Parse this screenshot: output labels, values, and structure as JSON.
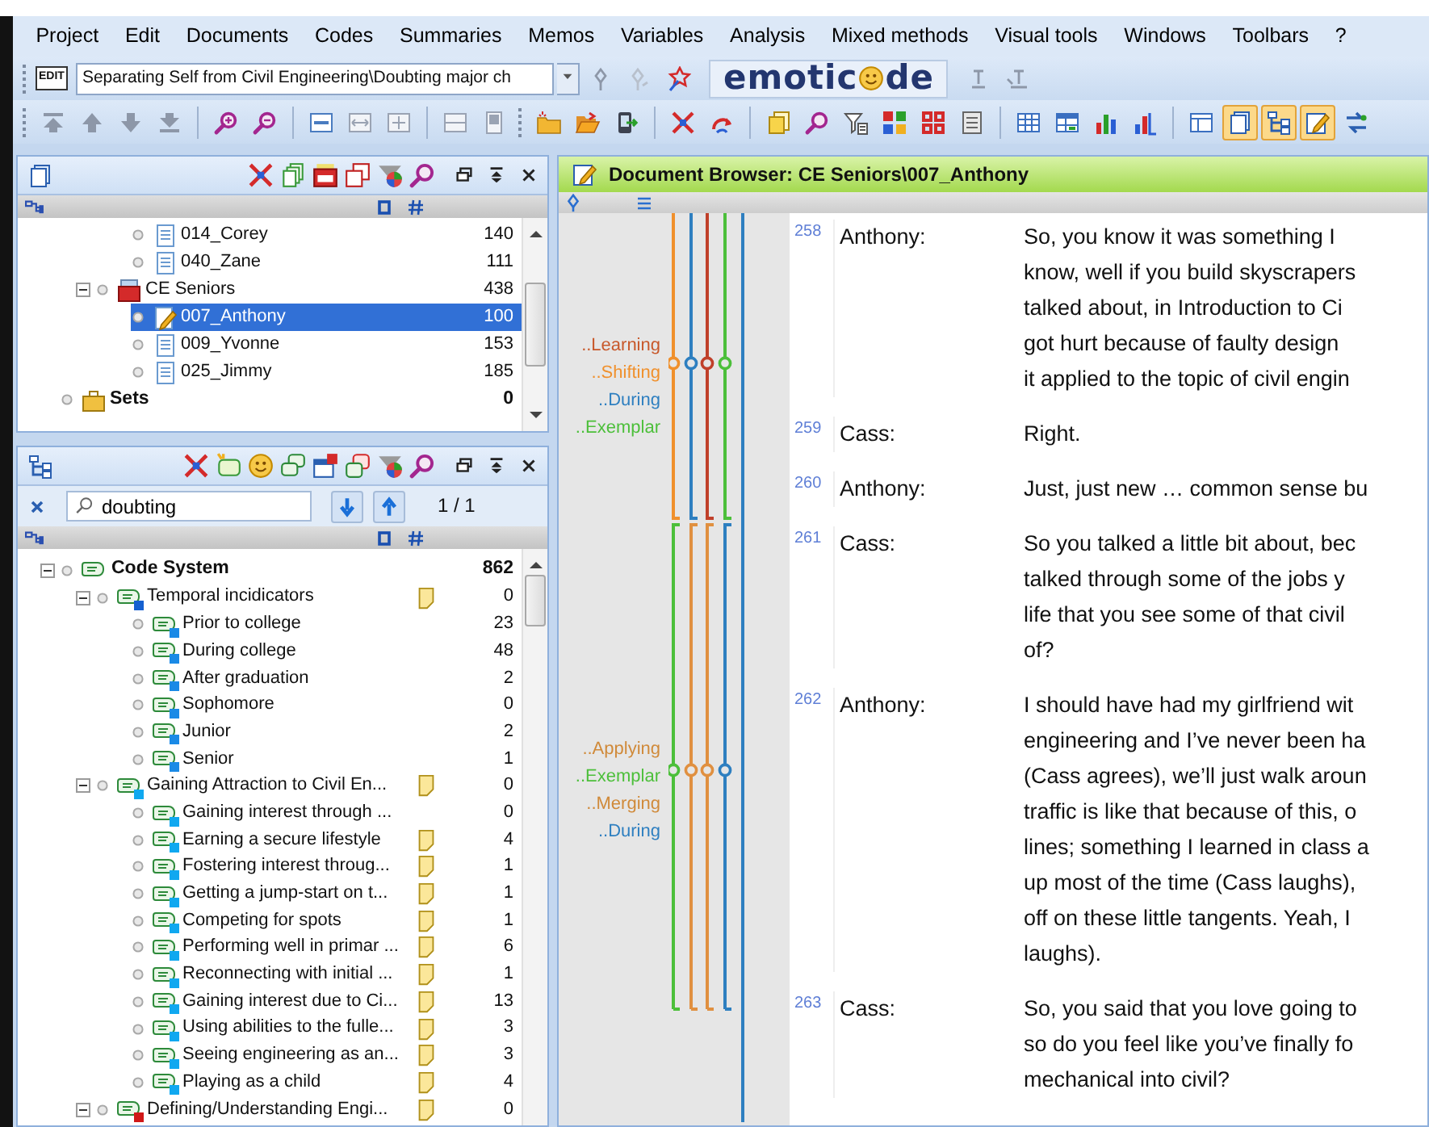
{
  "menu": [
    "Project",
    "Edit",
    "Documents",
    "Codes",
    "Summaries",
    "Memos",
    "Variables",
    "Analysis",
    "Mixed methods",
    "Visual tools",
    "Windows",
    "Toolbars",
    "?"
  ],
  "toolbar": {
    "edit_badge": "EDIT",
    "document_selector": {
      "value": "Separating Self from Civil Engineering\\Doubting major ch"
    },
    "logo": {
      "before": "emotic",
      "after": "de"
    },
    "window_toggles": [
      {
        "on": false
      },
      {
        "on": true
      },
      {
        "on": true
      },
      {
        "on": true
      }
    ]
  },
  "document_pane": {
    "items": [
      {
        "children": [
          {
            "children": [
              {
                "label": "014_Corey",
                "count": "140",
                "kind": "document",
                "selected": false
              },
              {
                "label": "040_Zane",
                "count": "111",
                "kind": "document",
                "selected": false
              }
            ]
          },
          {
            "label": "CE Seniors",
            "count": "438",
            "kind": "group",
            "expanded": true,
            "selected": false,
            "children": [
              {
                "label": "007_Anthony",
                "count": "100",
                "kind": "open-document",
                "selected": true
              },
              {
                "label": "009_Yvonne",
                "count": "153",
                "kind": "document",
                "selected": false
              },
              {
                "label": "025_Jimmy",
                "count": "185",
                "kind": "document",
                "selected": false
              }
            ]
          }
        ]
      },
      {
        "label": "Sets",
        "count": "0",
        "kind": "sets",
        "selected": false
      }
    ]
  },
  "code_pane": {
    "search": {
      "value": "doubting",
      "match_count": "1 / 1"
    },
    "items": [
      {
        "label": "Code System",
        "count": "862",
        "kind": "root",
        "expanded": true,
        "children": [
          {
            "label": "Temporal incidicators",
            "count": "0",
            "kind": "code",
            "memo": true,
            "color": "#1560d0",
            "expanded": true,
            "children": [
              {
                "label": "Prior to college",
                "count": "23",
                "kind": "code",
                "memo": false,
                "color": "#1a8ae6"
              },
              {
                "label": "During college",
                "count": "48",
                "kind": "code",
                "memo": false,
                "color": "#1a8ae6"
              },
              {
                "label": "After graduation",
                "count": "2",
                "kind": "code",
                "memo": false,
                "color": "#1a8ae6"
              },
              {
                "label": "Sophomore",
                "count": "0",
                "kind": "code",
                "memo": false,
                "color": "#1a8ae6"
              },
              {
                "label": "Junior",
                "count": "2",
                "kind": "code",
                "memo": false,
                "color": "#1a8ae6"
              },
              {
                "label": "Senior",
                "count": "1",
                "kind": "code",
                "memo": false,
                "color": "#1a8ae6"
              }
            ]
          },
          {
            "label": "Gaining Attraction to Civil En...",
            "count": "0",
            "kind": "code",
            "memo": true,
            "color": "#10a8f0",
            "expanded": true,
            "children": [
              {
                "label": "Gaining interest through ...",
                "count": "0",
                "kind": "code",
                "memo": false,
                "color": "#10a8f0"
              },
              {
                "label": "Earning a secure lifestyle",
                "count": "4",
                "kind": "code",
                "memo": true,
                "color": "#10a8f0"
              },
              {
                "label": "Fostering interest throug...",
                "count": "1",
                "kind": "code",
                "memo": true,
                "color": "#10a8f0"
              },
              {
                "label": "Getting a jump-start on t...",
                "count": "1",
                "kind": "code",
                "memo": true,
                "color": "#10a8f0"
              },
              {
                "label": "Competing for spots",
                "count": "1",
                "kind": "code",
                "memo": true,
                "color": "#10a8f0"
              },
              {
                "label": "Performing well in primar ...",
                "count": "6",
                "kind": "code",
                "memo": true,
                "color": "#10a8f0"
              },
              {
                "label": "Reconnecting with initial ...",
                "count": "1",
                "kind": "code",
                "memo": true,
                "color": "#10a8f0"
              },
              {
                "label": "Gaining interest due to Ci...",
                "count": "13",
                "kind": "code",
                "memo": true,
                "color": "#10a8f0"
              },
              {
                "label": "Using abilities to the fulle...",
                "count": "3",
                "kind": "code",
                "memo": true,
                "color": "#10a8f0"
              },
              {
                "label": "Seeing engineering as an...",
                "count": "3",
                "kind": "code",
                "memo": true,
                "color": "#10a8f0"
              },
              {
                "label": "Playing as a child",
                "count": "4",
                "kind": "code",
                "memo": true,
                "color": "#10a8f0"
              }
            ]
          },
          {
            "label": "Defining/Understanding Engi...",
            "count": "0",
            "kind": "code",
            "memo": true,
            "color": "#d01818",
            "expanded": true
          }
        ]
      }
    ]
  },
  "document_browser": {
    "title": "Document Browser: CE Seniors\\007_Anthony",
    "code_markers": [
      {
        "labels": [
          {
            "text": "..Learning",
            "color": "#c8582a"
          },
          {
            "text": "..Shifting",
            "color": "#f0902c"
          },
          {
            "text": "..During",
            "color": "#2e7fc0"
          },
          {
            "text": "..Exemplar",
            "color": "#4cbf3a"
          }
        ]
      },
      {
        "labels": [
          {
            "text": "..Applying",
            "color": "#d08a3a"
          },
          {
            "text": "..Exemplar",
            "color": "#4cbf3a"
          },
          {
            "text": "..Merging",
            "color": "#d08a3a"
          },
          {
            "text": "..During",
            "color": "#2e7fc0"
          }
        ]
      }
    ],
    "paragraphs": [
      {
        "number": "258",
        "speaker": "Anthony:",
        "lines": [
          "So, you know it was something I",
          "know, well if you build skyscrapers",
          "talked about, in Introduction to Ci",
          "got hurt because of faulty design",
          "it applied to the topic of civil engin"
        ]
      },
      {
        "number": "259",
        "speaker": "Cass:",
        "lines": [
          "Right."
        ]
      },
      {
        "number": "260",
        "speaker": "Anthony:",
        "lines": [
          "Just, just new … common sense bu"
        ]
      },
      {
        "number": "261",
        "speaker": "Cass:",
        "lines": [
          "So you talked a little bit about, bec",
          "talked through some of the jobs y",
          "life that you see some of that civil",
          "of?"
        ]
      },
      {
        "number": "262",
        "speaker": "Anthony:",
        "lines": [
          "I should have had my girlfriend wit",
          "engineering and I’ve never been ha",
          "(Cass agrees), we’ll just walk aroun",
          "traffic is like that because of this, o",
          "lines; something I learned in class a",
          "up most of the time (Cass laughs),",
          "off on these little tangents. Yeah, I",
          "laughs)."
        ]
      },
      {
        "number": "263",
        "speaker": "Cass:",
        "lines": [
          "So, you said that you love going to",
          "so do you feel like you’ve finally fo",
          "mechanical into civil?"
        ]
      }
    ]
  }
}
